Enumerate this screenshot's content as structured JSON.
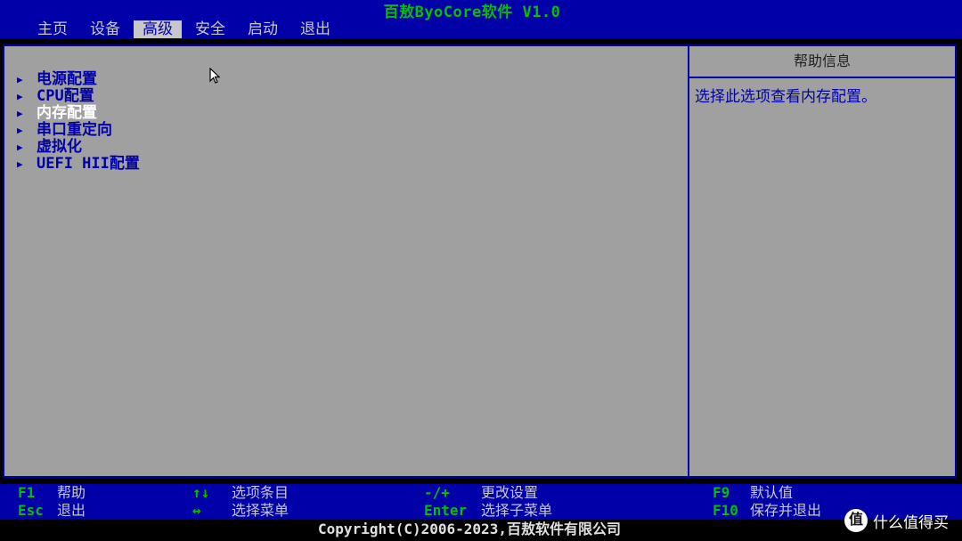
{
  "header": {
    "title": "百敖ByoCore软件 V1.0",
    "menu": [
      {
        "label": "主页"
      },
      {
        "label": "设备"
      },
      {
        "label": "高级"
      },
      {
        "label": "安全"
      },
      {
        "label": "启动"
      },
      {
        "label": "退出"
      }
    ],
    "active_menu": "高级"
  },
  "main": {
    "arrow_glyph": "▶",
    "items": [
      {
        "label": "电源配置"
      },
      {
        "label": "CPU配置"
      },
      {
        "label": "内存配置"
      },
      {
        "label": "串口重定向"
      },
      {
        "label": "虚拟化"
      },
      {
        "label": "UEFI HII配置"
      }
    ],
    "selected_item": "内存配置"
  },
  "help": {
    "title": "帮助信息",
    "text": "选择此选项查看内存配置。"
  },
  "keybar": {
    "groups": [
      {
        "rows": [
          {
            "key": "F1",
            "desc": "帮助"
          },
          {
            "key": "Esc",
            "desc": "退出"
          }
        ]
      },
      {
        "rows": [
          {
            "key": "↑↓",
            "desc": "选项条目"
          },
          {
            "key": "↔",
            "desc": "选择菜单"
          }
        ]
      },
      {
        "rows": [
          {
            "key": "-/+",
            "desc": "更改设置"
          },
          {
            "key": "Enter",
            "desc": "选择子菜单"
          }
        ]
      },
      {
        "rows": [
          {
            "key": "F9",
            "desc": "默认值"
          },
          {
            "key": "F10",
            "desc": "保存并退出"
          }
        ]
      }
    ]
  },
  "footer": {
    "copyright": "Copyright(C)2006-2023,百敖软件有限公司"
  },
  "watermark": {
    "logo": "值",
    "text": "什么值得买"
  },
  "colors": {
    "bios_blue": "#0000a8",
    "panel_gray": "#a0a0a0",
    "key_green": "#00c000",
    "text_light": "#c8c8c8",
    "selected_white": "#ffffff"
  }
}
